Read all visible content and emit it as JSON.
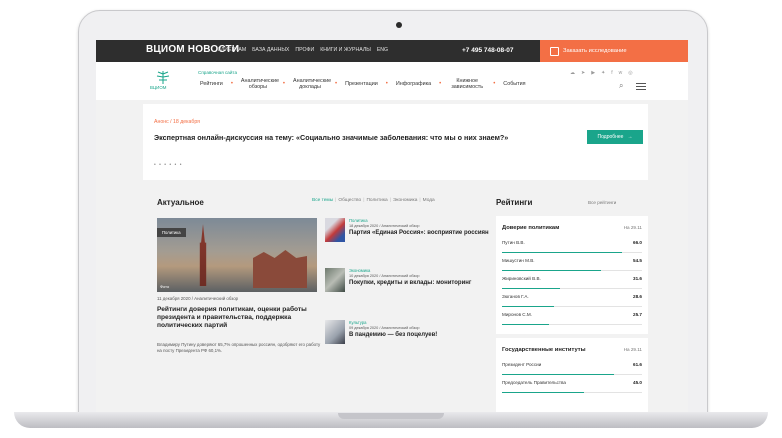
{
  "topbar": {
    "logo": "ВЦИОМ НОВОСТИ",
    "nav": [
      "КЛИЕНТАМ",
      "БАЗА ДАННЫХ",
      "ПРОФИ",
      "КНИГИ И ЖУРНАЛЫ",
      "ENG"
    ],
    "phone": "+7 495 748-08-07",
    "order_button": "Заказать исследование"
  },
  "header": {
    "logo_caption": "ВЦИОМ",
    "subtitle": "Справочная сайта",
    "nav": [
      "Рейтинги",
      "Аналитические обзоры",
      "Аналитические доклады",
      "Презентации",
      "Инфографика",
      "Книжное зависимость",
      "События"
    ],
    "social_icons": [
      "vk-icon",
      "telegram-icon",
      "youtube-icon",
      "twitter-icon",
      "facebook-icon",
      "vk-alt-icon",
      "ok-icon"
    ]
  },
  "announcement": {
    "kicker": "Анонс / 18 декабря",
    "title": "Экспертная онлайн-дискуссия на тему: «Социально значимые заболевания: что мы о них знаем?»",
    "button": "Подробнее",
    "pager": "• • • • • •"
  },
  "news": {
    "section_title": "Актуальное",
    "tabs": [
      "Все темы",
      "Общество",
      "Политика",
      "Экономика",
      "Мода"
    ],
    "main": {
      "tag": "Политика",
      "photo_label": "Фото",
      "date": "11 декабря 2020 / Аналитический обзор",
      "title": "Рейтинги доверия политикам, оценки работы президента и правительства, поддержка политических партий",
      "text": "Владимиру Путину доверяют 65,7% опрошенных россиян, одобряют его работу на посту Президента РФ 60,1%."
    },
    "side": [
      {
        "category": "Политика",
        "date": "18 декабря 2020 / Аналитический обзор",
        "title": "Партия «Единая Россия»: восприятие россиян"
      },
      {
        "category": "Экономика",
        "date": "10 декабря 2020 / Аналитический обзор",
        "title": "Покупки, кредиты и вклады: мониторинг"
      },
      {
        "category": "Культура",
        "date": "09 декабря 2020 / Аналитический обзор",
        "title": "В пандемию — без поцелуев!"
      }
    ]
  },
  "ratings": {
    "section_title": "Рейтинги",
    "all_link": "Все рейтинги",
    "cards": [
      {
        "title": "Доверие политикам",
        "date": "На 29.11",
        "rows": [
          {
            "name": "Путин В.В.",
            "value": "66.0",
            "share": 0.66
          },
          {
            "name": "Мишустин М.В.",
            "value": "54.5",
            "share": 0.545
          },
          {
            "name": "Жириновский В.В.",
            "value": "31.6",
            "share": 0.316
          },
          {
            "name": "Зюганов Г.А.",
            "value": "28.6",
            "share": 0.286
          },
          {
            "name": "Миронов С.М.",
            "value": "25.7",
            "share": 0.257
          }
        ]
      },
      {
        "title": "Государственные институты",
        "date": "На 29.11",
        "rows": [
          {
            "name": "Президент России",
            "value": "61.6",
            "share": 0.616
          },
          {
            "name": "Председатель Правительства",
            "value": "45.0",
            "share": 0.45
          }
        ]
      }
    ]
  }
}
